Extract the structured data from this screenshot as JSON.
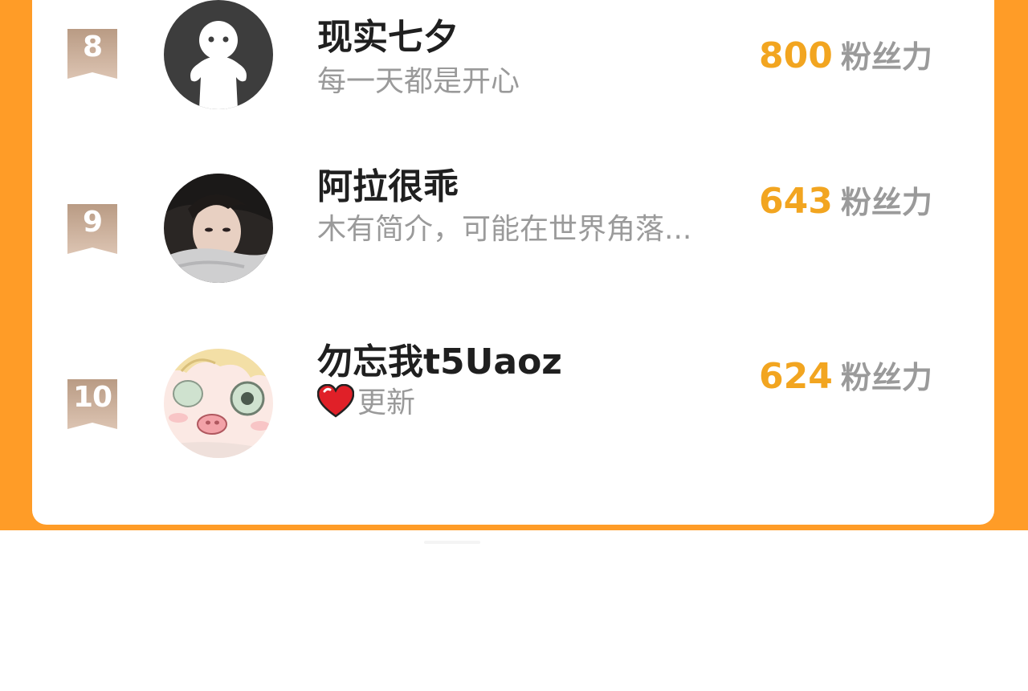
{
  "rows": [
    {
      "rank": "8",
      "name": "现实七夕",
      "bio": "每一天都是开心",
      "score": "800",
      "unit": "粉丝力",
      "avatar": "default-ghost-avatar"
    },
    {
      "rank": "9",
      "name": "阿拉很乖",
      "bio": "木有简介，可能在世界角落...",
      "score": "643",
      "unit": "粉丝力",
      "avatar": "photo-avatar"
    },
    {
      "rank": "10",
      "name": "勿忘我t5Uaoz",
      "bio": "更新",
      "score": "624",
      "unit": "粉丝力",
      "avatar": "cartoon-avatar",
      "bio_icon": "heart-icon"
    }
  ],
  "colors": {
    "background_accent": "#ff9c27",
    "score": "#f2a520",
    "rank_badge": "#c9ab94",
    "name": "#1f1f1f",
    "muted": "#9a9a9a"
  }
}
